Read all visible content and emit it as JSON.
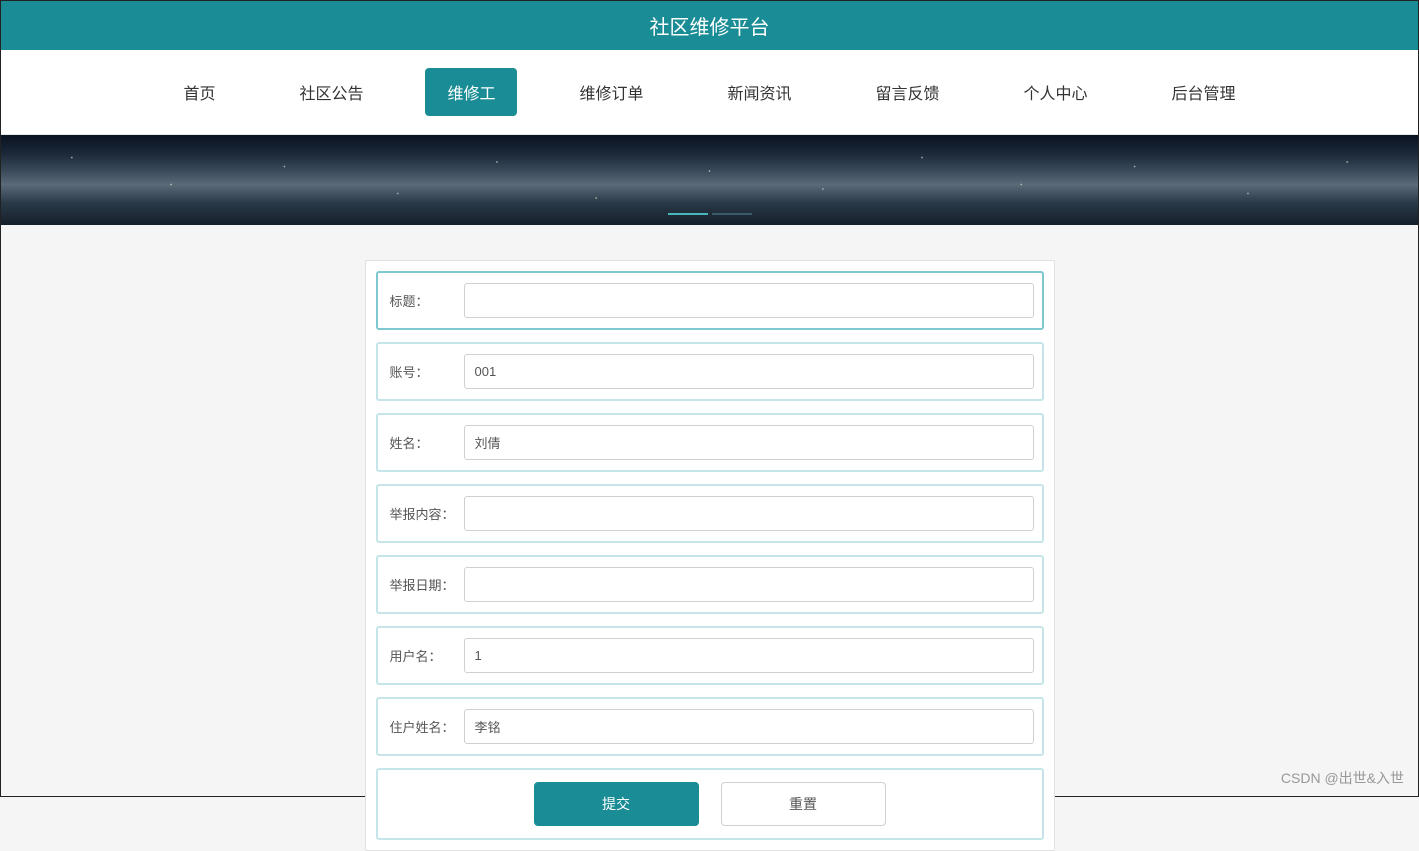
{
  "header": {
    "title": "社区维修平台"
  },
  "nav": {
    "items": [
      {
        "label": "首页",
        "active": false
      },
      {
        "label": "社区公告",
        "active": false
      },
      {
        "label": "维修工",
        "active": true
      },
      {
        "label": "维修订单",
        "active": false
      },
      {
        "label": "新闻资讯",
        "active": false
      },
      {
        "label": "留言反馈",
        "active": false
      },
      {
        "label": "个人中心",
        "active": false
      },
      {
        "label": "后台管理",
        "active": false
      }
    ]
  },
  "form": {
    "fields": [
      {
        "label": "标题：",
        "value": "",
        "focused": true
      },
      {
        "label": "账号：",
        "value": "001",
        "focused": false
      },
      {
        "label": "姓名：",
        "value": "刘倩",
        "focused": false
      },
      {
        "label": "举报内容：",
        "value": "",
        "focused": false
      },
      {
        "label": "举报日期：",
        "value": "",
        "focused": false
      },
      {
        "label": "用户名：",
        "value": "1",
        "focused": false
      },
      {
        "label": "住户姓名：",
        "value": "李铭",
        "focused": false
      }
    ],
    "buttons": {
      "submit": "提交",
      "reset": "重置"
    }
  },
  "watermark": "CSDN @出世&入世"
}
